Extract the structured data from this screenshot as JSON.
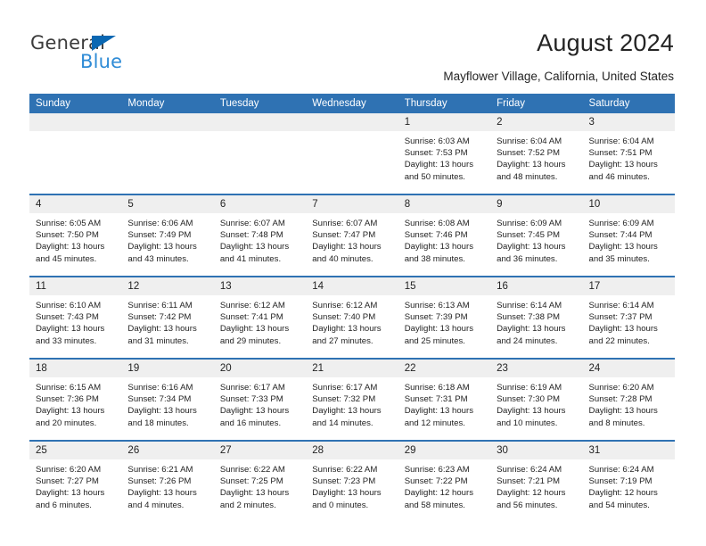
{
  "brand": {
    "name_top": "General",
    "name_bottom": "Blue",
    "accent_color": "#0a67b2",
    "accent_color_light": "#2e8bd6"
  },
  "header": {
    "title": "August 2024",
    "subtitle": "Mayflower Village, California, United States"
  },
  "theme": {
    "header_blue": "#2f72b3",
    "daynum_bg": "#efefef",
    "text": "#232323"
  },
  "calendar": {
    "weekday_headers": [
      "Sunday",
      "Monday",
      "Tuesday",
      "Wednesday",
      "Thursday",
      "Friday",
      "Saturday"
    ],
    "weeks": [
      [
        {
          "day": "",
          "empty": true
        },
        {
          "day": "",
          "empty": true
        },
        {
          "day": "",
          "empty": true
        },
        {
          "day": "",
          "empty": true
        },
        {
          "day": "1",
          "sunrise": "Sunrise: 6:03 AM",
          "sunset": "Sunset: 7:53 PM",
          "daylight": "Daylight: 13 hours and 50 minutes."
        },
        {
          "day": "2",
          "sunrise": "Sunrise: 6:04 AM",
          "sunset": "Sunset: 7:52 PM",
          "daylight": "Daylight: 13 hours and 48 minutes."
        },
        {
          "day": "3",
          "sunrise": "Sunrise: 6:04 AM",
          "sunset": "Sunset: 7:51 PM",
          "daylight": "Daylight: 13 hours and 46 minutes."
        }
      ],
      [
        {
          "day": "4",
          "sunrise": "Sunrise: 6:05 AM",
          "sunset": "Sunset: 7:50 PM",
          "daylight": "Daylight: 13 hours and 45 minutes."
        },
        {
          "day": "5",
          "sunrise": "Sunrise: 6:06 AM",
          "sunset": "Sunset: 7:49 PM",
          "daylight": "Daylight: 13 hours and 43 minutes."
        },
        {
          "day": "6",
          "sunrise": "Sunrise: 6:07 AM",
          "sunset": "Sunset: 7:48 PM",
          "daylight": "Daylight: 13 hours and 41 minutes."
        },
        {
          "day": "7",
          "sunrise": "Sunrise: 6:07 AM",
          "sunset": "Sunset: 7:47 PM",
          "daylight": "Daylight: 13 hours and 40 minutes."
        },
        {
          "day": "8",
          "sunrise": "Sunrise: 6:08 AM",
          "sunset": "Sunset: 7:46 PM",
          "daylight": "Daylight: 13 hours and 38 minutes."
        },
        {
          "day": "9",
          "sunrise": "Sunrise: 6:09 AM",
          "sunset": "Sunset: 7:45 PM",
          "daylight": "Daylight: 13 hours and 36 minutes."
        },
        {
          "day": "10",
          "sunrise": "Sunrise: 6:09 AM",
          "sunset": "Sunset: 7:44 PM",
          "daylight": "Daylight: 13 hours and 35 minutes."
        }
      ],
      [
        {
          "day": "11",
          "sunrise": "Sunrise: 6:10 AM",
          "sunset": "Sunset: 7:43 PM",
          "daylight": "Daylight: 13 hours and 33 minutes."
        },
        {
          "day": "12",
          "sunrise": "Sunrise: 6:11 AM",
          "sunset": "Sunset: 7:42 PM",
          "daylight": "Daylight: 13 hours and 31 minutes."
        },
        {
          "day": "13",
          "sunrise": "Sunrise: 6:12 AM",
          "sunset": "Sunset: 7:41 PM",
          "daylight": "Daylight: 13 hours and 29 minutes."
        },
        {
          "day": "14",
          "sunrise": "Sunrise: 6:12 AM",
          "sunset": "Sunset: 7:40 PM",
          "daylight": "Daylight: 13 hours and 27 minutes."
        },
        {
          "day": "15",
          "sunrise": "Sunrise: 6:13 AM",
          "sunset": "Sunset: 7:39 PM",
          "daylight": "Daylight: 13 hours and 25 minutes."
        },
        {
          "day": "16",
          "sunrise": "Sunrise: 6:14 AM",
          "sunset": "Sunset: 7:38 PM",
          "daylight": "Daylight: 13 hours and 24 minutes."
        },
        {
          "day": "17",
          "sunrise": "Sunrise: 6:14 AM",
          "sunset": "Sunset: 7:37 PM",
          "daylight": "Daylight: 13 hours and 22 minutes."
        }
      ],
      [
        {
          "day": "18",
          "sunrise": "Sunrise: 6:15 AM",
          "sunset": "Sunset: 7:36 PM",
          "daylight": "Daylight: 13 hours and 20 minutes."
        },
        {
          "day": "19",
          "sunrise": "Sunrise: 6:16 AM",
          "sunset": "Sunset: 7:34 PM",
          "daylight": "Daylight: 13 hours and 18 minutes."
        },
        {
          "day": "20",
          "sunrise": "Sunrise: 6:17 AM",
          "sunset": "Sunset: 7:33 PM",
          "daylight": "Daylight: 13 hours and 16 minutes."
        },
        {
          "day": "21",
          "sunrise": "Sunrise: 6:17 AM",
          "sunset": "Sunset: 7:32 PM",
          "daylight": "Daylight: 13 hours and 14 minutes."
        },
        {
          "day": "22",
          "sunrise": "Sunrise: 6:18 AM",
          "sunset": "Sunset: 7:31 PM",
          "daylight": "Daylight: 13 hours and 12 minutes."
        },
        {
          "day": "23",
          "sunrise": "Sunrise: 6:19 AM",
          "sunset": "Sunset: 7:30 PM",
          "daylight": "Daylight: 13 hours and 10 minutes."
        },
        {
          "day": "24",
          "sunrise": "Sunrise: 6:20 AM",
          "sunset": "Sunset: 7:28 PM",
          "daylight": "Daylight: 13 hours and 8 minutes."
        }
      ],
      [
        {
          "day": "25",
          "sunrise": "Sunrise: 6:20 AM",
          "sunset": "Sunset: 7:27 PM",
          "daylight": "Daylight: 13 hours and 6 minutes."
        },
        {
          "day": "26",
          "sunrise": "Sunrise: 6:21 AM",
          "sunset": "Sunset: 7:26 PM",
          "daylight": "Daylight: 13 hours and 4 minutes."
        },
        {
          "day": "27",
          "sunrise": "Sunrise: 6:22 AM",
          "sunset": "Sunset: 7:25 PM",
          "daylight": "Daylight: 13 hours and 2 minutes."
        },
        {
          "day": "28",
          "sunrise": "Sunrise: 6:22 AM",
          "sunset": "Sunset: 7:23 PM",
          "daylight": "Daylight: 13 hours and 0 minutes."
        },
        {
          "day": "29",
          "sunrise": "Sunrise: 6:23 AM",
          "sunset": "Sunset: 7:22 PM",
          "daylight": "Daylight: 12 hours and 58 minutes."
        },
        {
          "day": "30",
          "sunrise": "Sunrise: 6:24 AM",
          "sunset": "Sunset: 7:21 PM",
          "daylight": "Daylight: 12 hours and 56 minutes."
        },
        {
          "day": "31",
          "sunrise": "Sunrise: 6:24 AM",
          "sunset": "Sunset: 7:19 PM",
          "daylight": "Daylight: 12 hours and 54 minutes."
        }
      ]
    ]
  }
}
